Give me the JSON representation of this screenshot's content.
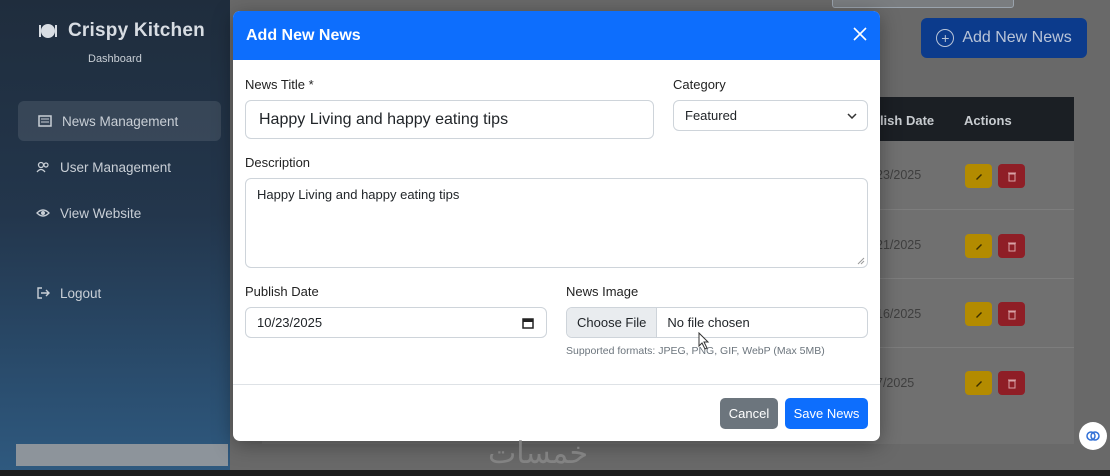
{
  "sidebar": {
    "brand": "Crispy Kitchen",
    "subtitle": "Dashboard",
    "items": [
      {
        "label": "News Management",
        "icon": "newspaper-icon"
      },
      {
        "label": "User Management",
        "icon": "users-icon"
      },
      {
        "label": "View Website",
        "icon": "eye-icon"
      },
      {
        "label": "Logout",
        "icon": "logout-icon"
      }
    ]
  },
  "header": {
    "add_button": "Add New News"
  },
  "table": {
    "headers": [
      "Publish Date",
      "Actions"
    ],
    "header_partial": [
      "blish Date",
      "Actions"
    ],
    "rows": [
      "23/2025",
      "21/2025",
      "16/2025",
      "7/2025"
    ]
  },
  "modal": {
    "title": "Add New News",
    "news_title_label": "News Title *",
    "news_title_value": "Happy Living and happy eating tips",
    "category_label": "Category",
    "category_value": "Featured",
    "description_label": "Description",
    "description_value": "Happy Living and happy eating tips",
    "publish_date_label": "Publish Date",
    "publish_date_value": "10/23/2025",
    "image_label": "News Image",
    "choose_file": "Choose File",
    "no_file": "No file chosen",
    "help_text": "Supported formats: JPEG, PNG, GIF, WebP (Max 5MB)",
    "cancel": "Cancel",
    "save": "Save News"
  },
  "watermark": "خمسات",
  "colors": {
    "primary": "#0d6efd",
    "secondary": "#6c757d",
    "warning": "#ffc107",
    "danger": "#dc3545"
  }
}
